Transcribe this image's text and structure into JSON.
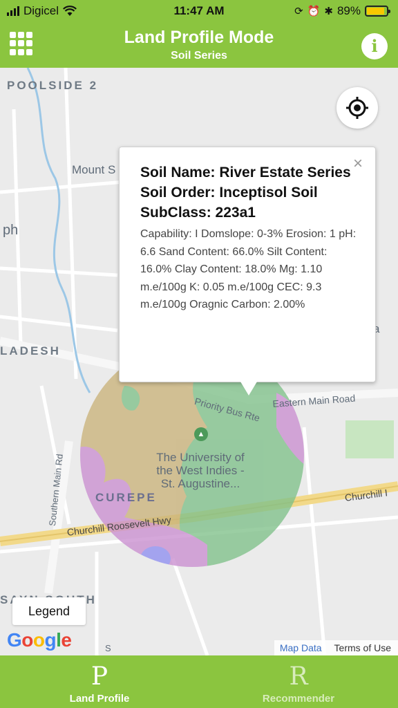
{
  "status_bar": {
    "carrier": "Digicel",
    "time": "11:47 AM",
    "battery": "89%",
    "battery_level": 0.89
  },
  "header": {
    "title": "Land Profile Mode",
    "subtitle": "Soil Series",
    "info_label": "i"
  },
  "map": {
    "labels": {
      "poolside": "POOLSIDE 2",
      "mount": "Mount S",
      "ph": "ph",
      "ladesh": "LADESH",
      "curepe": "CUREPE",
      "university": "The University of the West Indies - St. Augustine...",
      "priority_bus": "Priority Bus Rte",
      "eastern_main": "Eastern Main Road",
      "churchill_left": "Churchill Roosevelt Hwy",
      "churchill_right": "Churchill I",
      "southern_main": "Southern Main Rd",
      "sayn_south": "SAYN SOUTH",
      "edge_a": "a",
      "edge_s": "S"
    },
    "legend_label": "Legend",
    "google_logo": "Google",
    "map_data_link": "Map Data",
    "terms_link": "Terms of Use"
  },
  "popup": {
    "heading": "Soil Name: River Estate Series Soil Order: Inceptisol Soil SubClass: 223a1",
    "details": "Capability: I Domslope: 0-3% Erosion: 1 pH: 6.6 Sand Content: 66.0% Silt Content: 16.0% Clay Content: 18.0% Mg: 1.10 m.e/100g K: 0.05 m.e/100g CEC: 9.3 m.e/100g Oragnic Carbon: 2.00%",
    "close_symbol": "×"
  },
  "tabs": [
    {
      "glyph": "P",
      "label": "Land Profile",
      "active": true
    },
    {
      "glyph": "R",
      "label": "Recommender",
      "active": false
    }
  ],
  "colors": {
    "brand_green": "#8bc53f",
    "soil_tan": "#c9b27a",
    "soil_green": "#7fc08a",
    "soil_purple": "#c98fd0",
    "soil_blue": "#8f8ff0"
  }
}
